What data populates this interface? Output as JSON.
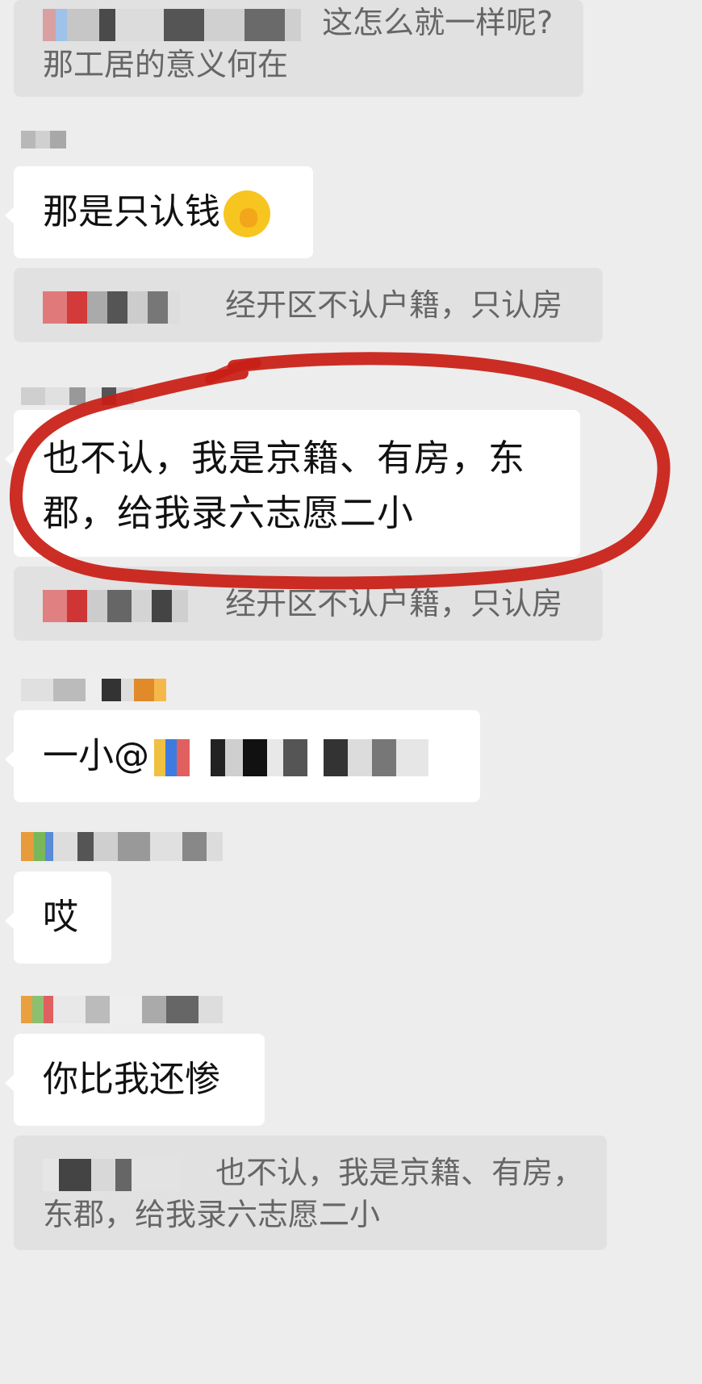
{
  "messages": {
    "quote1": {
      "text_tail": "这怎么就一样呢?",
      "line2": "那工居的意义何在"
    },
    "bubble1": {
      "text": "那是只认钱"
    },
    "quote2": {
      "text": "经开区不认户籍，只认房"
    },
    "bubble2": {
      "line1": "也不认，我是京籍、有房，东",
      "line2": "郡，给我录六志愿二小"
    },
    "quote3": {
      "text": "经开区不认户籍，只认房"
    },
    "bubble3": {
      "text": "一小@"
    },
    "bubble4": {
      "text": "哎"
    },
    "bubble5": {
      "text": "你比我还惨"
    },
    "quote4": {
      "line1": "也不认，我是京籍、有房，",
      "line2": "东郡，给我录六志愿二小"
    }
  },
  "icons": {
    "emoji": "hand-over-mouth-emoji",
    "annotation": "red-hand-drawn-circle"
  },
  "colors": {
    "background": "#ededed",
    "bubble": "#ffffff",
    "quote": "#e1e1e1",
    "annotation": "#c81e14"
  }
}
